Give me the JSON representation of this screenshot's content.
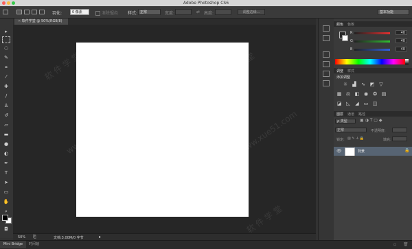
{
  "app": {
    "title": "Adobe Photoshop CS6",
    "traffic_colors": [
      "#fc605c",
      "#fdbc40",
      "#34c84a"
    ]
  },
  "options_bar": {
    "feather_label": "羽化:",
    "feather_value": "0 像素",
    "antialias_label": "消除锯齿",
    "style_label": "样式:",
    "style_value": "正常",
    "width_label": "宽度:",
    "height_label": "高度:",
    "refine_edge_button": "调整边缘...",
    "workspace_value": "基本功能"
  },
  "document": {
    "tab_title": "软件学堂 @ 50%(RGB/8)",
    "zoom": "50%",
    "doc_info": "文档:3.00M/0 字节"
  },
  "bottom_tabs": [
    "Mini Bridge",
    "时间轴"
  ],
  "color_panel": {
    "tabs": [
      "颜色",
      "色板"
    ],
    "channels": [
      {
        "label": "R",
        "value": "40",
        "color": "#e03030"
      },
      {
        "label": "G",
        "value": "40",
        "color": "#30c030"
      },
      {
        "label": "B",
        "value": "40",
        "color": "#3060e0"
      }
    ]
  },
  "adjustments_panel": {
    "tabs": [
      "调整",
      "样式"
    ],
    "title": "添加调整",
    "icons_row1": [
      "brightness-icon",
      "levels-icon",
      "curves-icon",
      "exposure-icon",
      "vibrance-icon"
    ],
    "icons_row2": [
      "hue-sat-icon",
      "color-balance-icon",
      "bw-icon",
      "photo-filter-icon",
      "channel-mixer-icon",
      "color-lookup-icon"
    ],
    "icons_row3": [
      "invert-icon",
      "posterize-icon",
      "threshold-icon",
      "gradient-map-icon",
      "selective-color-icon"
    ]
  },
  "layers_panel": {
    "tabs": [
      "图层",
      "通道",
      "路径"
    ],
    "filter_label": "ρ 类型",
    "blend_mode": "正常",
    "opacity_label": "不透明度:",
    "lock_label": "锁定:",
    "fill_label": "填充:",
    "layer_name": "背景"
  },
  "watermarks": [
    "软 件 学 堂",
    "www.xue51.com"
  ]
}
